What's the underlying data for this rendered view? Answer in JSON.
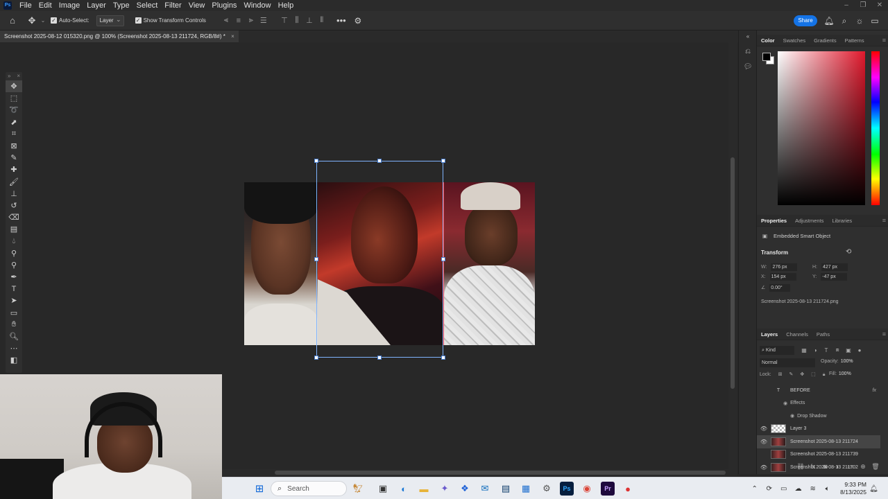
{
  "menu": {
    "logo": "Ps",
    "items": [
      "File",
      "Edit",
      "Image",
      "Layer",
      "Type",
      "Select",
      "Filter",
      "View",
      "Plugins",
      "Window",
      "Help"
    ]
  },
  "options_bar": {
    "auto_select_label": "Auto-Select:",
    "auto_select_target": "Layer",
    "show_transform_label": "Show Transform Controls",
    "share_label": "Share"
  },
  "document": {
    "tab_title": "Screenshot 2025-08-12 015320.png @ 100% (Screenshot 2025-08-13 211724, RGB/8#) *",
    "close_glyph": "×"
  },
  "color_panel": {
    "tabs": [
      "Color",
      "Swatches",
      "Gradients",
      "Patterns"
    ],
    "active_tab": "Color",
    "foreground": "#000000",
    "background": "#ffffff",
    "picker_hue": "#e0182c"
  },
  "properties_panel": {
    "tabs": [
      "Properties",
      "Adjustments",
      "Libraries"
    ],
    "active_tab": "Properties",
    "object_type": "Embedded Smart Object",
    "transform_title": "Transform",
    "w_label": "W:",
    "w_value": "276 px",
    "h_label": "H:",
    "h_value": "427 px",
    "x_label": "X:",
    "x_value": "154 px",
    "y_label": "Y:",
    "y_value": "-47 px",
    "angle_value": "0.00°",
    "linked_file": "Screenshot 2025-08-13 211724.png"
  },
  "layers_panel": {
    "tabs": [
      "Layers",
      "Channels",
      "Paths"
    ],
    "active_tab": "Layers",
    "kind_label": "Kind",
    "blend_mode": "Normal",
    "opacity_label": "Opacity:",
    "opacity_value": "100%",
    "lock_label": "Lock:",
    "fill_label": "Fill:",
    "fill_value": "100%",
    "layers": [
      {
        "name": "BEFORE",
        "kind": "text",
        "visible": false,
        "selected": false,
        "fx": "fx"
      },
      {
        "name": "Effects",
        "kind": "sub1"
      },
      {
        "name": "Drop Shadow",
        "kind": "sub2"
      },
      {
        "name": "Layer 3",
        "kind": "pixel",
        "visible": true,
        "selected": false
      },
      {
        "name": "Screenshot 2025-08-13 211724",
        "kind": "smart",
        "visible": true,
        "selected": true
      },
      {
        "name": "Screenshot 2025-08-13 211739",
        "kind": "smart",
        "visible": false,
        "selected": false
      },
      {
        "name": "Screenshot 2025-08-13 211702",
        "kind": "smart",
        "visible": true,
        "selected": false
      }
    ]
  },
  "taskbar": {
    "search_placeholder": "Search",
    "time": "9:33 PM",
    "date": "8/13/2025"
  },
  "colors": {
    "accent": "#1473e6",
    "selection": "#7fb4ff"
  }
}
